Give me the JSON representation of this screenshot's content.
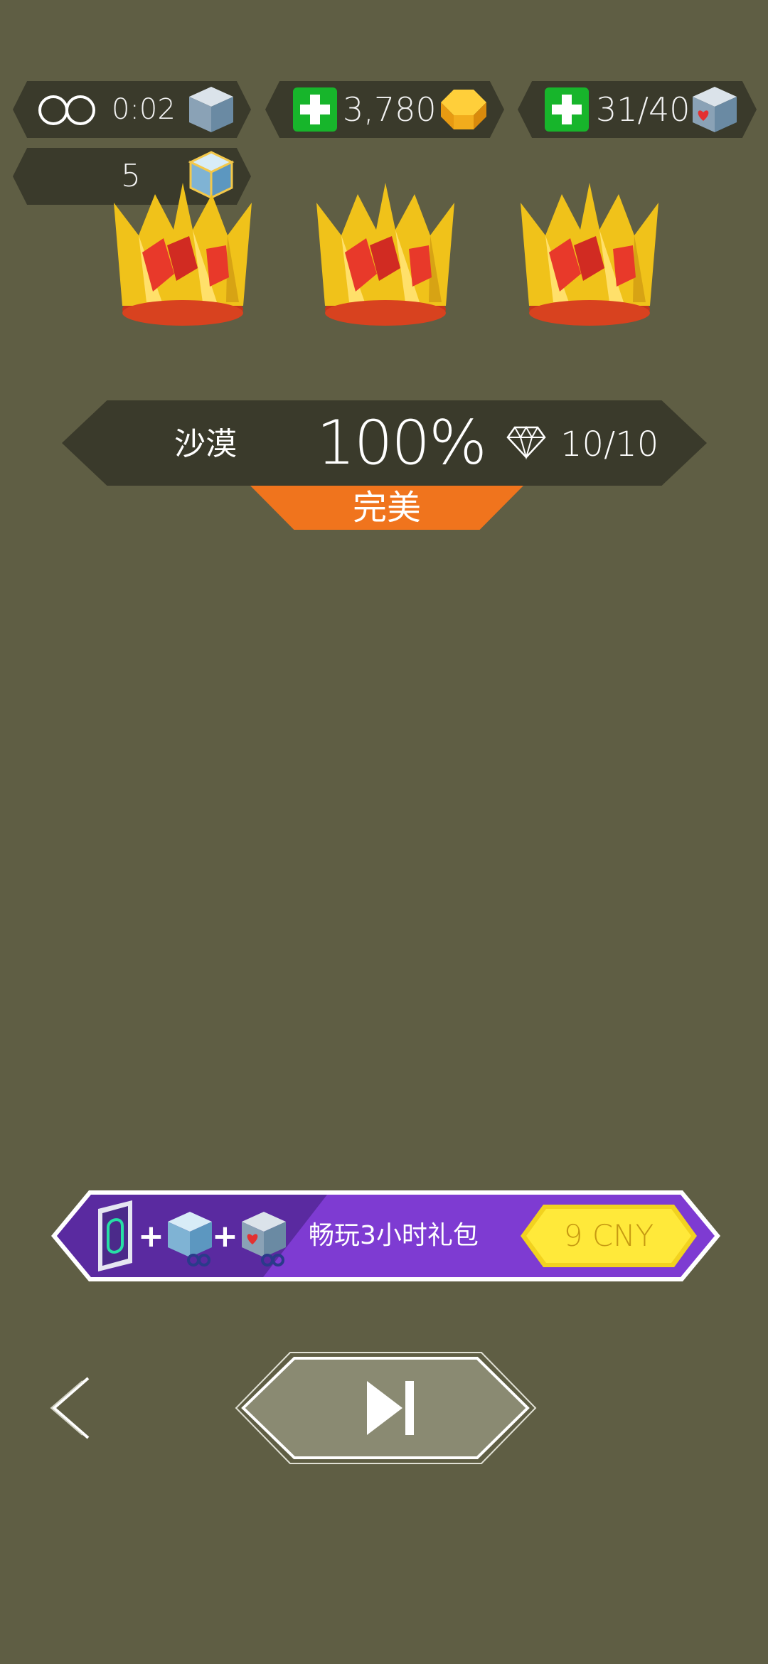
{
  "hud": {
    "timer_value": "0:02",
    "coins_value": "3,780",
    "hearts_value": "31/40",
    "cubes_value": "5"
  },
  "result": {
    "level_name": "沙漠",
    "percent": "100%",
    "gems": "10/10",
    "rating": "完美",
    "crowns_earned": 3
  },
  "promo": {
    "title": "畅玩3小时礼包",
    "price": "9 CNY"
  },
  "colors": {
    "background": "#5f5e44",
    "pill": "#3a3a2b",
    "rating_orange": "#f0741d",
    "promo_purple": "#7e3bd2",
    "price_yellow": "#ffe93a",
    "plus_green": "#17b52b"
  },
  "icons": {
    "timer": "infinity-icon",
    "coins": "gold-cube-icon",
    "hearts": "heart-cube-icon",
    "cubes": "blue-cube-icon",
    "gems": "diamond-icon",
    "back": "chevron-left-icon",
    "next": "skip-next-icon"
  }
}
